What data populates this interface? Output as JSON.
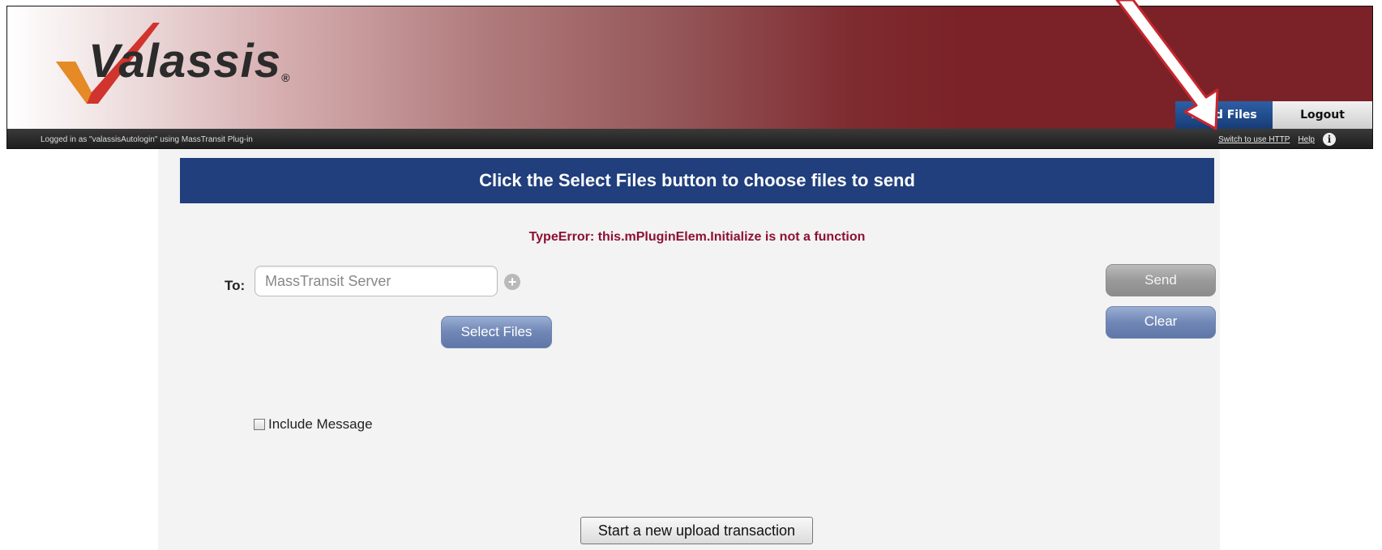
{
  "header": {
    "logo_text": "Valassis",
    "logo_mark": "®",
    "status_text": "Logged in as \"valassisAutologin\" using MassTransit Plug-in",
    "links": {
      "switch_http": "Switch to use HTTP",
      "help": "Help"
    },
    "info_icon": "i",
    "tabs": {
      "send_files": "Send Files",
      "logout": "Logout"
    }
  },
  "main": {
    "title": "Click the Select Files button to choose files to send",
    "error": "TypeError: this.mPluginElem.Initialize is not a function",
    "to_label": "To:",
    "to_value": "MassTransit Server",
    "add_icon": "+",
    "select_files": "Select Files",
    "send": "Send",
    "clear": "Clear",
    "include_message": "Include Message",
    "start_new": "Start a new upload transaction"
  },
  "colors": {
    "header_red": "#7a2227",
    "title_blue": "#203f7c",
    "error": "#8d1034",
    "annotation_arrow": "#c8262d"
  },
  "icons": [
    "plus-circle-icon",
    "info-icon",
    "checkbox-icon",
    "logo-check-icon",
    "annotation-arrow-icon"
  ]
}
